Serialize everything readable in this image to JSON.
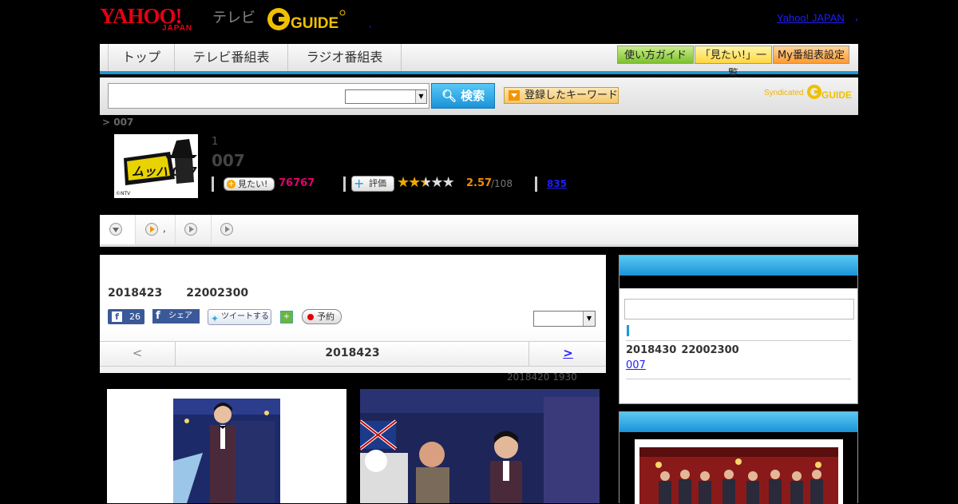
{
  "header": {
    "yahoo_logo": "YAHOO!",
    "yahoo_sub": "JAPAN",
    "tv_label": "テレビ",
    "gguide_logo": "GUIDE",
    "top_link": "Yahoo! JAPAN",
    "top_dot": ",",
    "mid_dot": ","
  },
  "nav": {
    "tabs": [
      "トップ",
      "テレビ番組表",
      "ラジオ番組表"
    ],
    "buttons": [
      "使い方ガイド",
      "「見たい!」一覧",
      "My番組表設定"
    ]
  },
  "search": {
    "input_value": "",
    "select_value": "",
    "button_label": "検索",
    "keyword_button": "登録したキーワード",
    "syndicated": "Syndicated",
    "syndicated_logo": "GUIDE"
  },
  "breadcrumb": "> 007",
  "program": {
    "episode": "1",
    "title": "007",
    "want_label": "見たい!",
    "want_count": "76767",
    "rate_label": "評価",
    "rating_stars": 2.5,
    "rating_value": "2.57",
    "rating_count": "/108",
    "review_count": "835",
    "thumb_text": "ムッハ 007",
    "thumb_copyright": "©NTV"
  },
  "subtabs": {
    "tab2_label": ","
  },
  "main": {
    "broadcast_date": "2018423",
    "broadcast_time": "22002300",
    "fb_like": "f",
    "fb_count": "26",
    "fb_share": "シェア",
    "tweet": "ツイートする",
    "share_icon_label": "+",
    "reserve": "予約",
    "select_value": "",
    "date_prev": "<",
    "date_current": "2018423",
    "date_next": ">",
    "updated": "2018420  1930"
  },
  "side": {
    "next_date": "2018430",
    "next_time": "22002300",
    "next_link": "007"
  },
  "colors": {
    "accent_blue": "#1b9ad6",
    "want_pink": "#e5006e",
    "rating_orange": "#f08c00",
    "yahoo_red": "#e60012"
  }
}
